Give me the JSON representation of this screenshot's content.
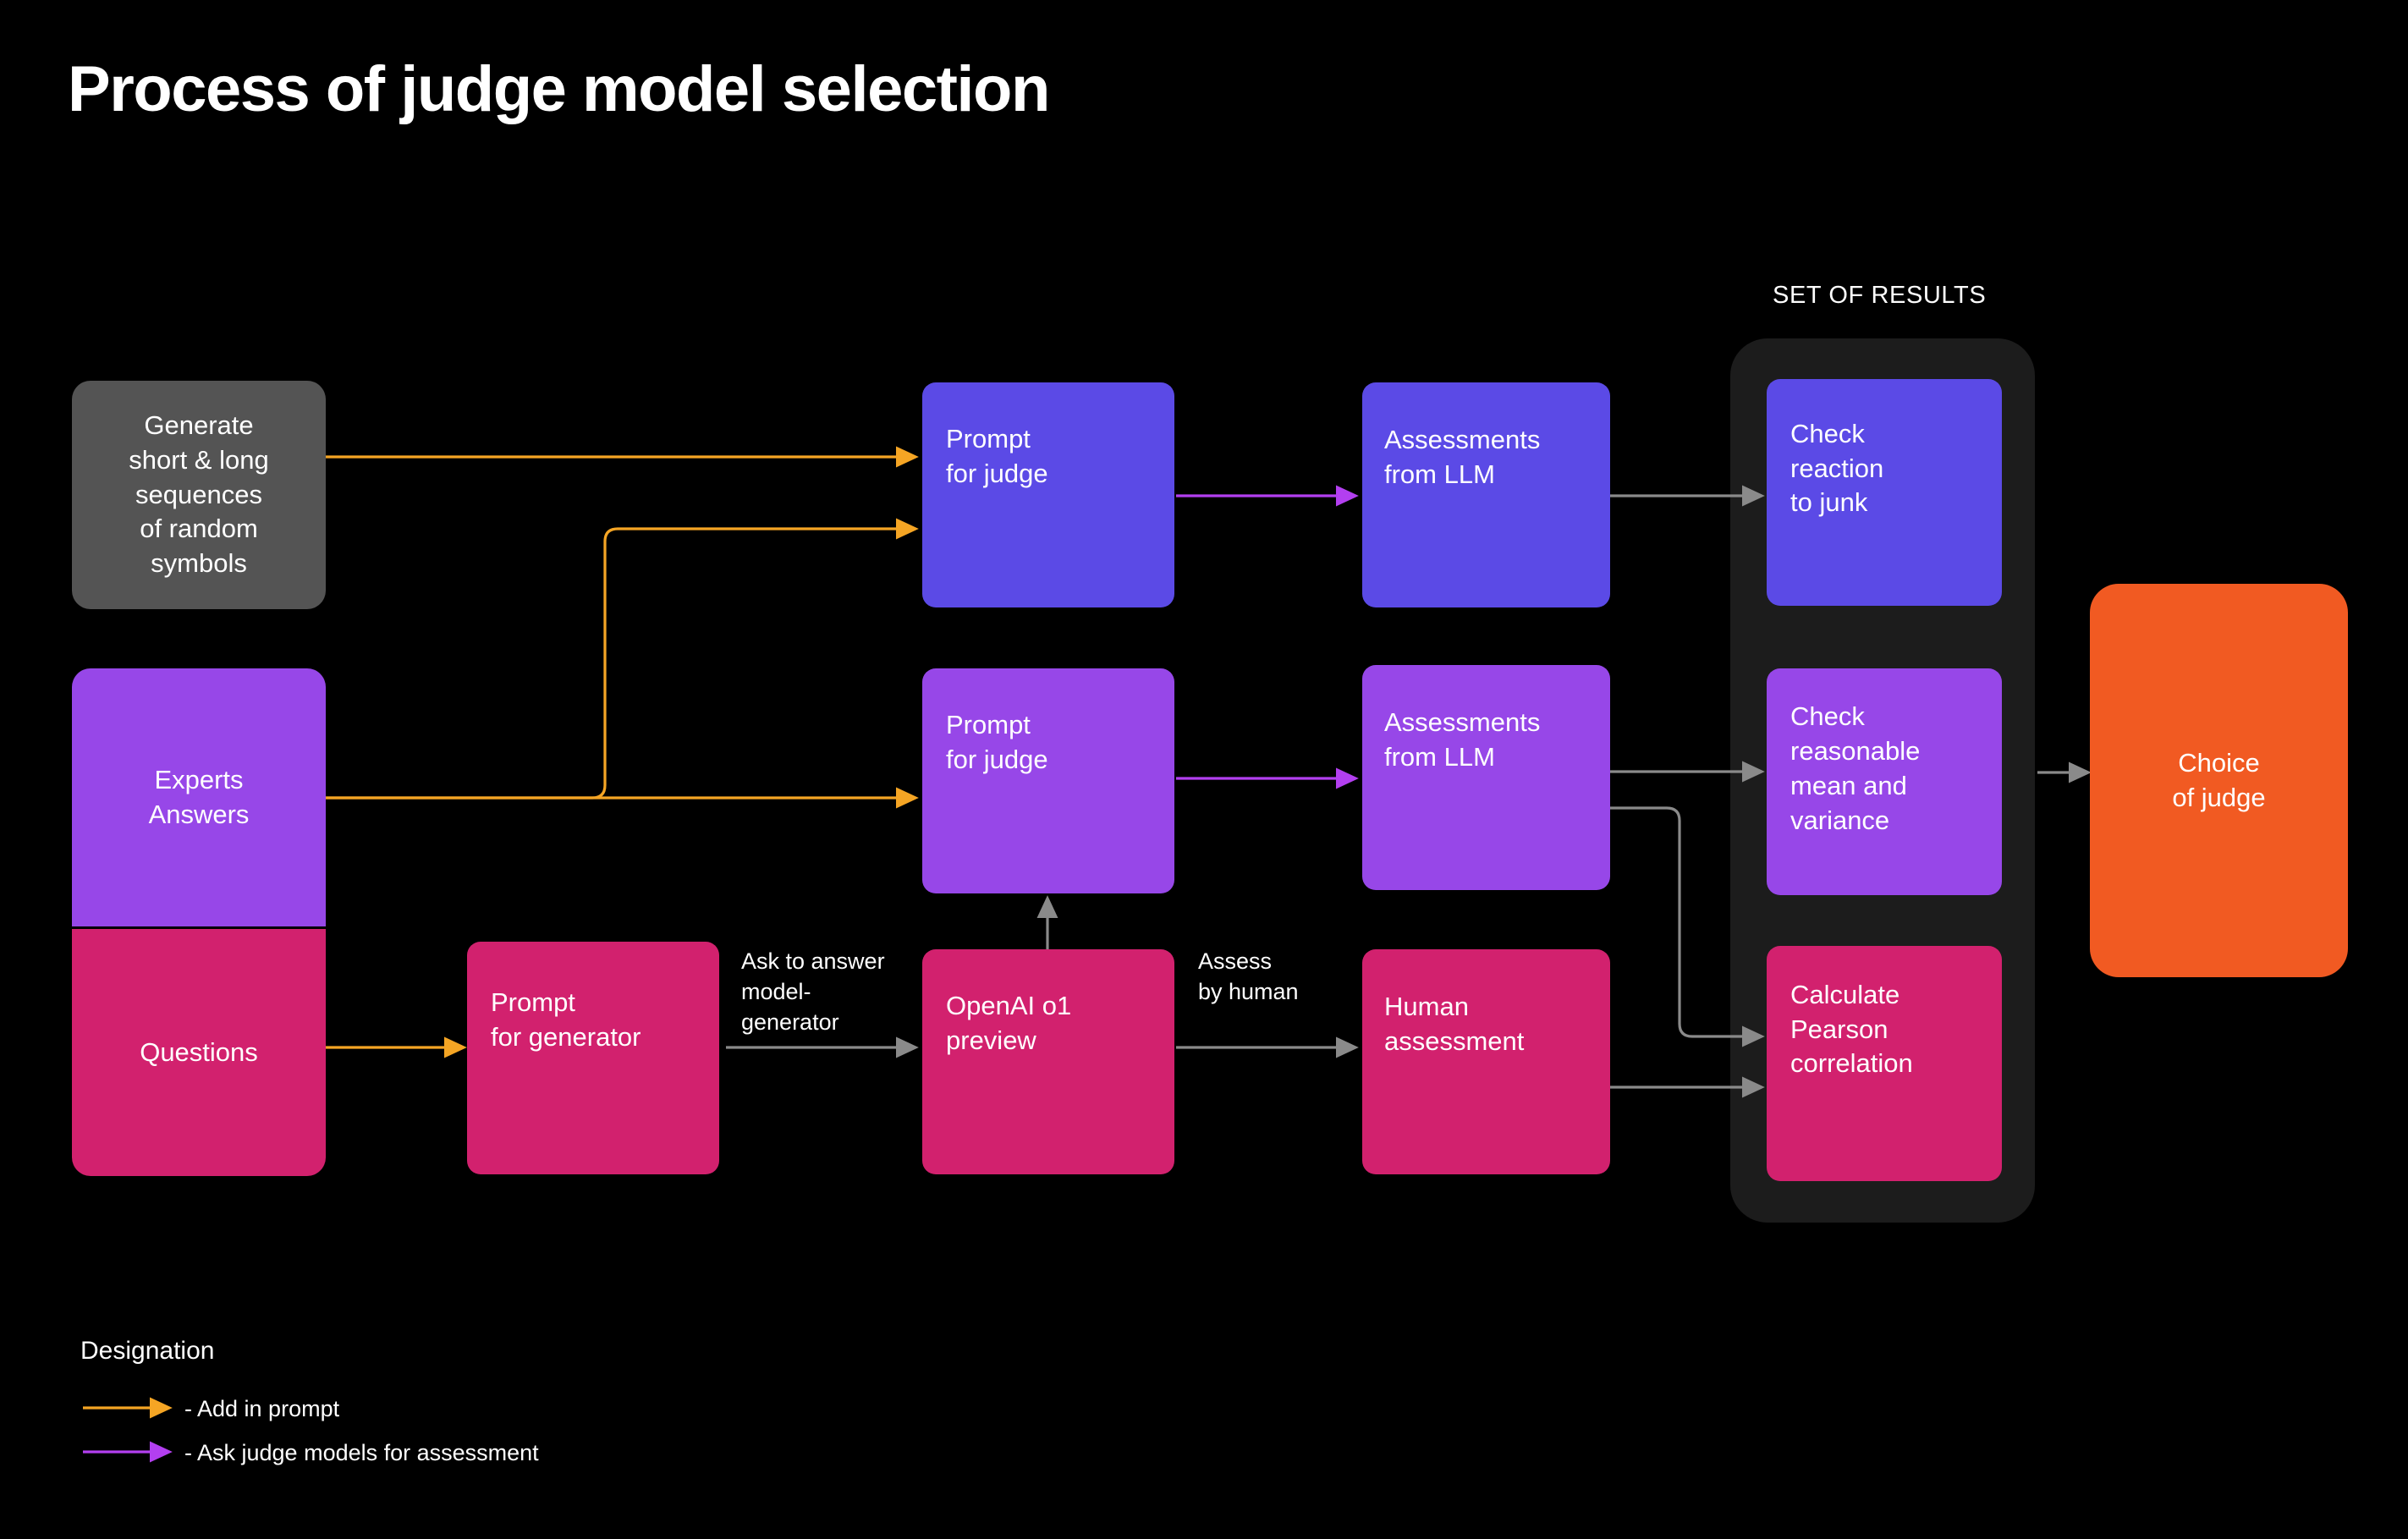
{
  "page": {
    "title": "Process of judge model selection",
    "background": "#000000"
  },
  "colors": {
    "gray": "#545454",
    "purple": "#9747E8",
    "pink": "#D2216E",
    "blue": "#5B4AE6",
    "orange": "#F15A22",
    "frame": "#1C1C1C",
    "arrow_gray": "#8A8A8A",
    "arrow_orange": "#F5A524",
    "arrow_violet": "#B33FF0"
  },
  "group": {
    "set_of_results_label": "SET OF RESULTS"
  },
  "nodes": {
    "generate_random": "Generate\nshort & long\nsequences\nof random\nsymbols",
    "experts_answers": "Experts\nAnswers",
    "questions": "Questions",
    "prompt_for_judge_top": "Prompt\nfor judge",
    "prompt_for_judge_mid": "Prompt\nfor judge",
    "prompt_for_generator": "Prompt\nfor generator",
    "openai_o1_preview": "OpenAI o1\npreview",
    "assessments_from_llm_top": "Assessments\nfrom LLM",
    "assessments_from_llm_mid": "Assessments\nfrom LLM",
    "human_assessment": "Human\nassessment",
    "check_reaction_to_junk": "Check\nreaction\nto junk",
    "check_mean_variance": "Check\nreasonable\nmean and\nvariance",
    "calculate_pearson": "Calculate\nPearson\ncorrelation",
    "choice_of_judge": "Choice\nof judge"
  },
  "edge_labels": {
    "ask_to_answer": "Ask to answer\nmodel-\ngenerator",
    "assess_by_human": "Assess\nby human"
  },
  "legend": {
    "title": "Designation",
    "items": [
      {
        "color": "#F5A524",
        "text": "- Add in prompt"
      },
      {
        "color": "#B33FF0",
        "text": "- Ask judge models for assessment"
      }
    ]
  }
}
